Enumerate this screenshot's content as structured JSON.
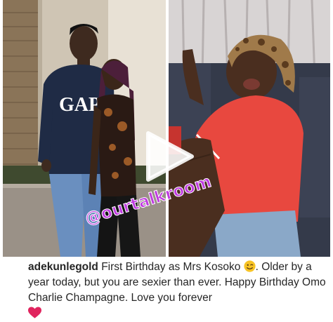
{
  "post": {
    "watermark": "@ourtalkroom",
    "play_button_icon": "play-icon",
    "caption": {
      "username": "adekunlegold",
      "text_part1": "First Birthday as Mrs Kosoko",
      "emoji": "winking-face-emoji",
      "text_part2": ". Older by a year today, but you are sexier than ever. Happy Birthday Omo Charlie Champagne. Love you forever",
      "heart": "red-heart-emoji"
    },
    "photos": [
      {
        "shirt_text": "GAP"
      }
    ],
    "colors": {
      "watermark": "#c03be0",
      "heart": "#e0245e",
      "text": "#262626"
    }
  }
}
